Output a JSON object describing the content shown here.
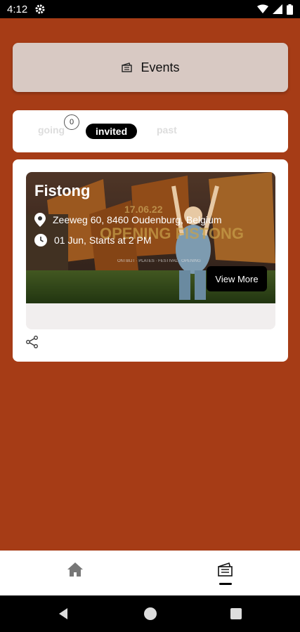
{
  "status": {
    "time": "4:12"
  },
  "header": {
    "title": "Events",
    "icon": "ticket-icon"
  },
  "tabs": {
    "going": "going",
    "going_count": "0",
    "invited": "invited",
    "past": "past",
    "selected": "invited"
  },
  "event": {
    "title": "Fistong",
    "location": "Zeeweg 60, 8460 Oudenburg, Belgium",
    "time": "01 Jun, Starts at 2 PM",
    "view_more": "View More",
    "poster_date": "17.06.22",
    "poster_title": "OPENING FISTONG",
    "poster_subtitle": "ONTBIJT · PLATES · FESTIVAL · OPENING"
  },
  "nav": {
    "home_icon": "home-icon",
    "events_icon": "ticket-icon"
  },
  "colors": {
    "background": "#a63c16",
    "header_card": "#d8c9c3",
    "accent": "#000000"
  }
}
